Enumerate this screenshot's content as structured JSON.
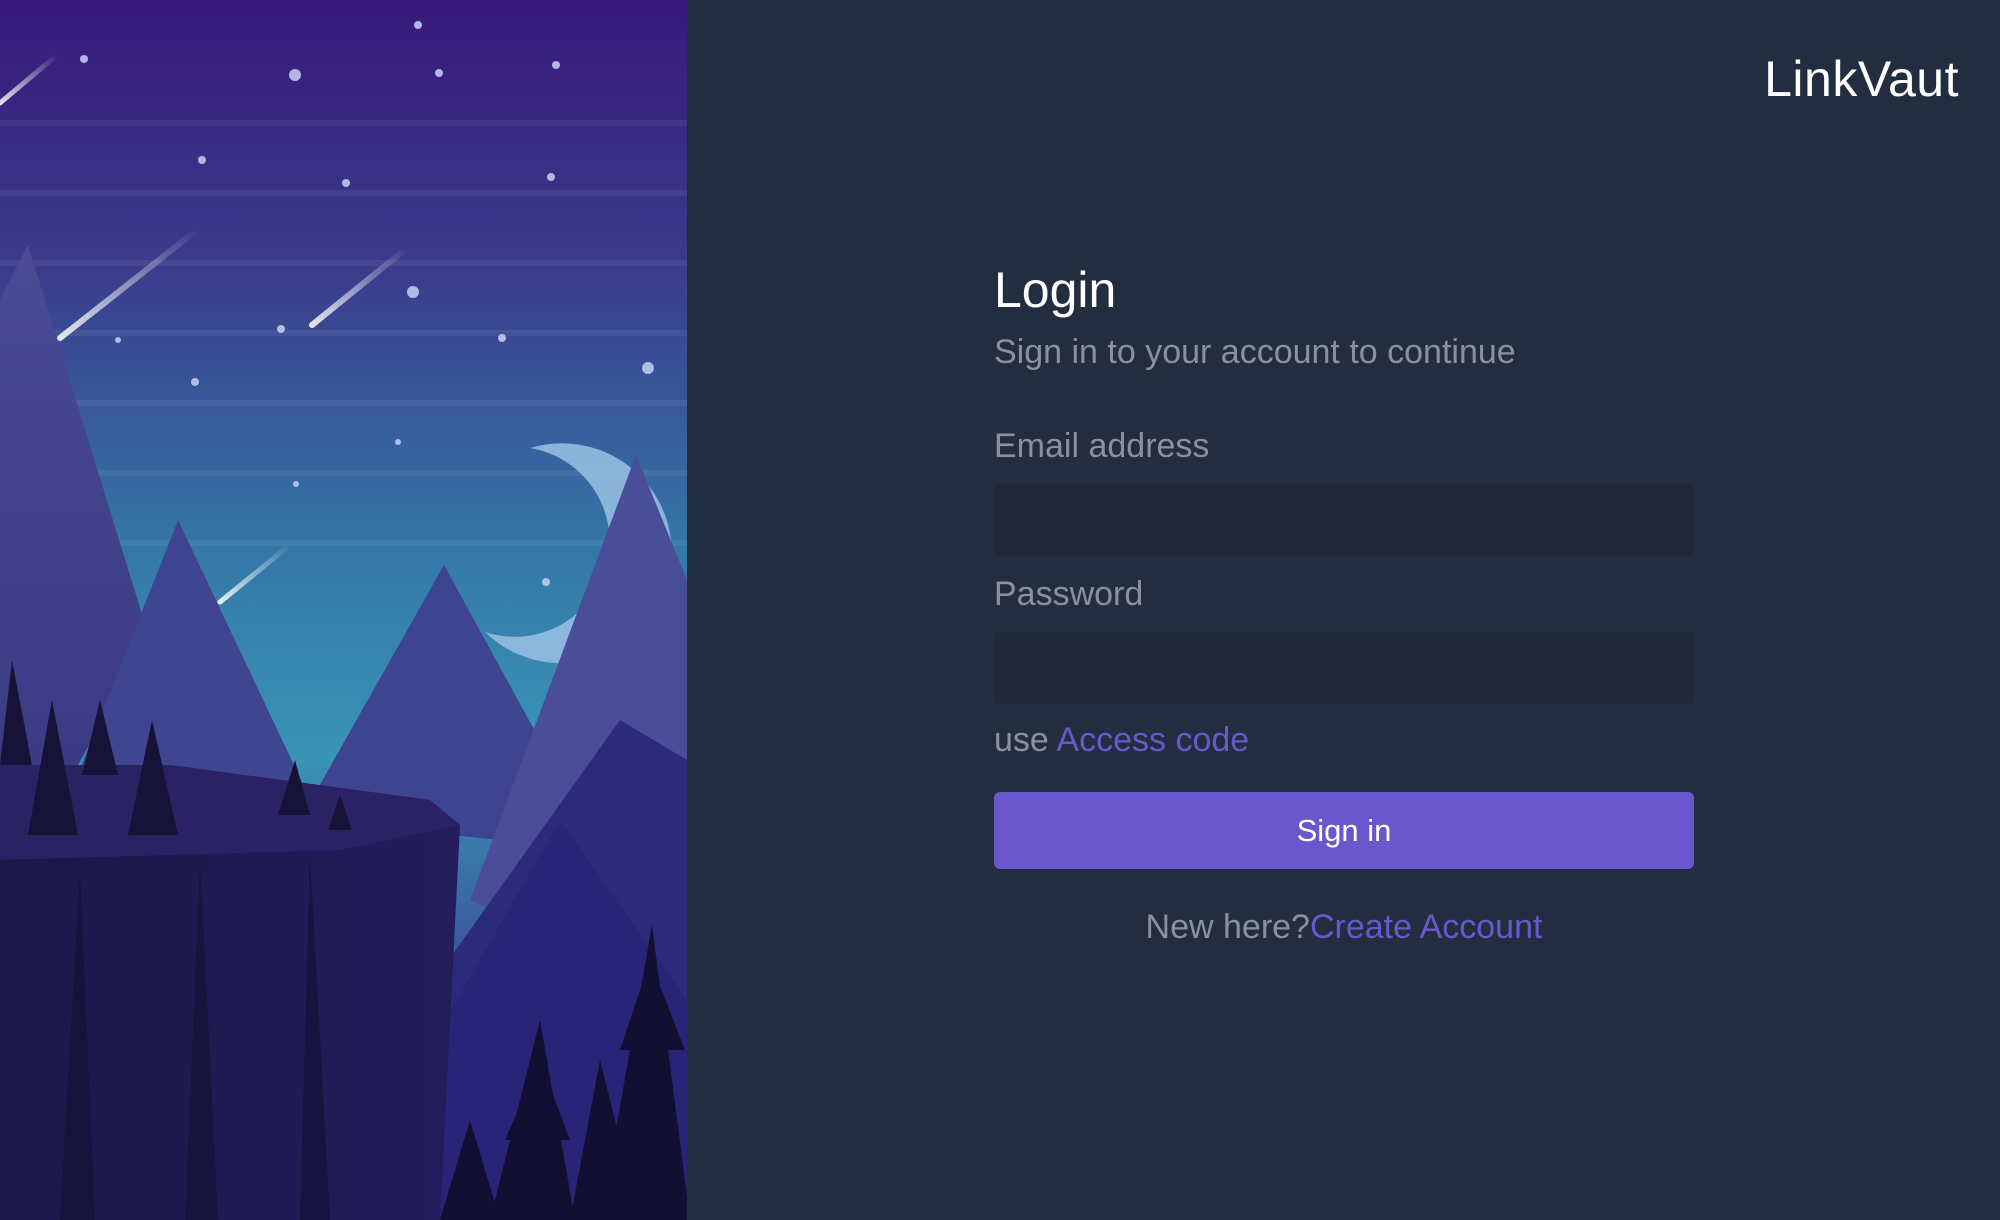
{
  "brand": {
    "name": "LinkVaut"
  },
  "login": {
    "title": "Login",
    "subtitle": "Sign in to your account to continue",
    "email_label": "Email address",
    "email_value": "",
    "password_label": "Password",
    "password_value": "",
    "access_prefix": "use",
    "access_link": "Access code",
    "signin_label": "Sign in",
    "new_here": "New here?",
    "create_account": "Create Account"
  },
  "colors": {
    "background": "#222e3f",
    "input_background": "#1f2836",
    "accent": "#6a57cd",
    "link": "#6759cc",
    "muted_text": "#8a919c"
  }
}
